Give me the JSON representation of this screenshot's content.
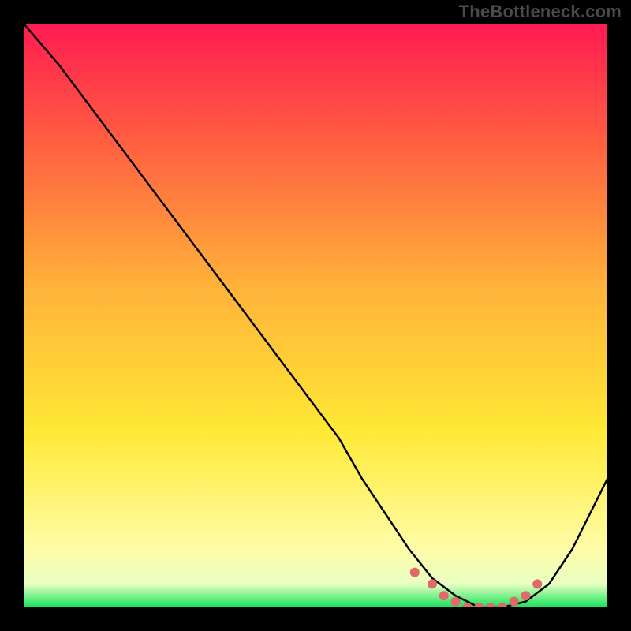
{
  "watermark": "TheBottleneck.com",
  "colors": {
    "bg_black": "#000000",
    "grad_top": "#ff1b52",
    "grad_upper": "#ff5e41",
    "grad_mid": "#ffb23a",
    "grad_lower": "#ffe936",
    "grad_pale": "#fffca8",
    "grad_green": "#16e35a",
    "curve": "#000000",
    "highlight": "#e06a6a",
    "watermark": "#4a4a4a"
  },
  "chart_data": {
    "type": "line",
    "title": "",
    "xlabel": "",
    "ylabel": "",
    "xlim": [
      0,
      100
    ],
    "ylim": [
      0,
      100
    ],
    "series": [
      {
        "name": "bottleneck-curve",
        "x": [
          0,
          6,
          12,
          18,
          24,
          30,
          36,
          42,
          48,
          54,
          58,
          62,
          66,
          70,
          74,
          78,
          82,
          86,
          90,
          94,
          100
        ],
        "y": [
          100,
          93,
          85,
          77,
          69,
          61,
          53,
          45,
          37,
          29,
          22,
          16,
          10,
          5,
          2,
          0,
          0,
          1,
          4,
          10,
          22
        ]
      }
    ],
    "highlight_segment": {
      "name": "optimal-zone-dots",
      "x": [
        67,
        70,
        72,
        74,
        76,
        78,
        80,
        82,
        84,
        86,
        88
      ],
      "y": [
        6,
        4,
        2,
        1,
        0,
        0,
        0,
        0,
        1,
        2,
        4
      ]
    },
    "gradient_stops": [
      {
        "offset": 0.0,
        "color": "#ff1b52"
      },
      {
        "offset": 0.2,
        "color": "#ff5e41"
      },
      {
        "offset": 0.45,
        "color": "#ffb23a"
      },
      {
        "offset": 0.7,
        "color": "#ffe936"
      },
      {
        "offset": 0.9,
        "color": "#fffca8"
      },
      {
        "offset": 0.96,
        "color": "#e8ffc2"
      },
      {
        "offset": 1.0,
        "color": "#16e35a"
      }
    ]
  }
}
